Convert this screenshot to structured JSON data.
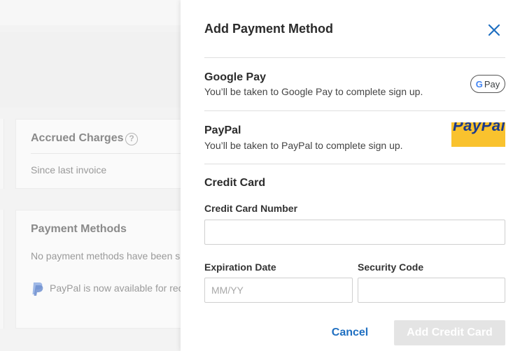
{
  "background": {
    "accrued_charges": {
      "title": "Accrued Charges",
      "help_icon": "question-circle-icon",
      "subtitle": "Since last invoice"
    },
    "payment_methods": {
      "title": "Payment Methods",
      "empty_text": "No payment methods have been s",
      "paypal_notice_icon": "paypal-icon",
      "paypal_notice": "PayPal is now available for rec"
    }
  },
  "drawer": {
    "title": "Add Payment Method",
    "close_icon": "close-icon",
    "methods": [
      {
        "name": "Google Pay",
        "description": "You’ll be taken to Google Pay to complete sign up.",
        "badge_g": "G",
        "badge_text": "Pay"
      },
      {
        "name": "PayPal",
        "description": "You’ll be taken to PayPal to complete sign up.",
        "logo_text": "PayPal"
      }
    ],
    "credit_card": {
      "title": "Credit Card",
      "number_label": "Credit Card Number",
      "number_value": "",
      "expiration_label": "Expiration Date",
      "expiration_placeholder": "MM/YY",
      "security_label": "Security Code",
      "security_value": ""
    },
    "actions": {
      "cancel_label": "Cancel",
      "submit_label": "Add Credit Card"
    }
  },
  "colors": {
    "accent": "#1f6fc1",
    "paypal_yellow": "#f9c22e",
    "paypal_blue": "#1b3a8c",
    "disabled_button": "#e4e4e4"
  }
}
